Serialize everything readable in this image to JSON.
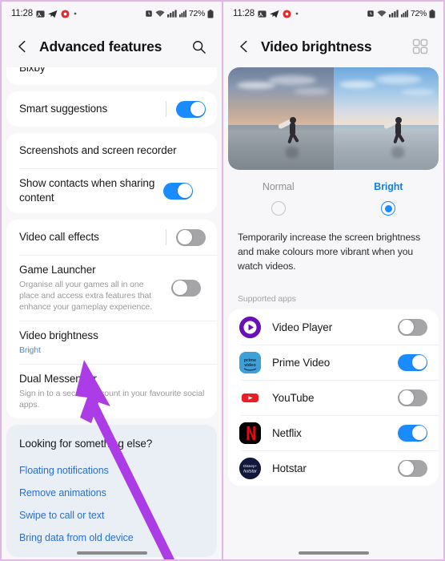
{
  "status_bar": {
    "time": "11:28",
    "battery_percent": "72%",
    "icons": [
      "gallery-icon",
      "telegram-icon",
      "record-icon",
      "dot-icon",
      "alarm-icon",
      "wifi-icon",
      "signal-icon",
      "signal2-icon",
      "battery-icon"
    ]
  },
  "left_screen": {
    "title": "Advanced features",
    "back_icon": "back-chevron-icon",
    "search_icon": "search-icon",
    "partial_top_item": "Bixby",
    "groups": [
      {
        "rows": [
          {
            "title": "Smart suggestions",
            "sub": "",
            "toggle": "on",
            "has_divider": true
          }
        ]
      },
      {
        "rows": [
          {
            "title": "Screenshots and screen recorder",
            "sub": "",
            "toggle": "none",
            "has_divider": false
          },
          {
            "title": "Show contacts when sharing content",
            "sub": "",
            "toggle": "on",
            "has_divider": false
          }
        ]
      },
      {
        "rows": [
          {
            "title": "Video call effects",
            "sub": "",
            "toggle": "off",
            "has_divider": true
          },
          {
            "title": "Game Launcher",
            "sub": "Organise all your games all in one place and access extra features that enhance your gameplay experience.",
            "toggle": "off",
            "has_divider": false
          },
          {
            "title": "Video brightness",
            "sub": "Bright",
            "sub_accent": true,
            "toggle": "none",
            "has_divider": false
          },
          {
            "title": "Dual Messenger",
            "sub": "Sign in to a second account in your favourite social apps.",
            "toggle": "none",
            "has_divider": false
          }
        ]
      }
    ],
    "looking_for": {
      "title": "Looking for something else?",
      "links": [
        "Floating notifications",
        "Remove animations",
        "Swipe to call or text",
        "Bring data from old device"
      ]
    }
  },
  "right_screen": {
    "title": "Video brightness",
    "back_icon": "back-chevron-icon",
    "grid_icon": "apps-grid-icon",
    "preview": {
      "left_label": "normal-preview-image",
      "right_label": "bright-preview-image"
    },
    "modes": [
      {
        "label": "Normal",
        "selected": false
      },
      {
        "label": "Bright",
        "selected": true
      }
    ],
    "description": "Temporarily increase the screen brightness and make colours more vibrant when you watch videos.",
    "supported_apps_label": "Supported apps",
    "apps": [
      {
        "name": "Video Player",
        "icon": "video-player-icon",
        "toggle": "off"
      },
      {
        "name": "Prime Video",
        "icon": "prime-video-icon",
        "toggle": "on"
      },
      {
        "name": "YouTube",
        "icon": "youtube-icon",
        "toggle": "off"
      },
      {
        "name": "Netflix",
        "icon": "netflix-icon",
        "toggle": "on"
      },
      {
        "name": "Hotstar",
        "icon": "hotstar-icon",
        "toggle": "off"
      }
    ]
  },
  "colors": {
    "accent_blue": "#1a8cff",
    "link_blue": "#2b6fd4",
    "cursor_purple": "#a33ce0",
    "panel_bg": "#eaeef5"
  },
  "cursor": {
    "name": "mouse-pointer-arrow"
  }
}
